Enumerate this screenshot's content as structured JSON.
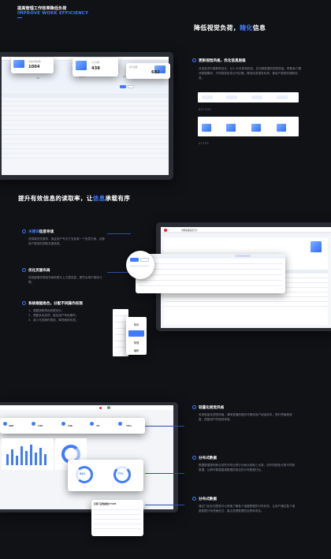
{
  "header": {
    "title_cn": "提高管理工作效率降低负荷",
    "title_en": "IMPROVE WORK EFFICIENCY"
  },
  "section1": {
    "heading_pre": "降低视觉负荷，",
    "heading_accent": "精化",
    "heading_post": "信息",
    "point_title": "更新视觉风格，优化信息层级",
    "point_body": "对信息进行更新再设计，以1.3x字体和弃选，并切换数据的视觉层级，帮助每个模块数据模块，不同类型信息分开区隔，降低信息视觉负荷，使用户更快的捕获信息。",
    "before_label": "BEFORE",
    "after_label": "AFTER",
    "stats": [
      {
        "label": "在线车辆总数",
        "value": "1004"
      },
      {
        "label": "今日新增",
        "value": "438"
      },
      {
        "label": "累计总数",
        "value": "682"
      }
    ]
  },
  "section2": {
    "heading_pre": "提升有效信息的读取率，让",
    "heading_accent": "信息",
    "heading_post": "承载有序",
    "points": [
      {
        "title_accent": "关键词",
        "title_post": "信息导读",
        "body": "选择高亮关键词，保证用户专注于当前某一个信息方面，且使用户更快的获取关键信息。"
      },
      {
        "title_accent": "",
        "title_post": "优化页面布局",
        "body": "将批量操作按钮布局到表头上方更突显，更符合用户使用习惯。"
      },
      {
        "title_accent": "",
        "title_post": "系统根据角色，分配不同操作权限",
        "body": "1、调整按照角色权限划分。\n2、调整多余选项，保证用户有用操作。\n3、减少可选操作按钮，降低使用负担。"
      }
    ],
    "menu": [
      "新增",
      "管理",
      "编辑"
    ],
    "app_title": "中国联通运营门户"
  },
  "section3": {
    "points": [
      {
        "title": "轻量化视觉风格",
        "body": "采用轻量化视觉风格，清晰易懂的图形可降低用户阅读成本，提升界面美观度，提高用户的使用体验。"
      },
      {
        "title": "分布式数据",
        "body": "根据数据类别和业务的不同分类行为两大类和三大类，用不同颜色代表不同的数据，让跨环数据直观数据的各自的分布数据行业。"
      },
      {
        "title": "分布式数据",
        "body": "通过门店标志图表可以快速了解各个维度数据的分布状态，让用户通过各个维度数据分布快速定位。重点查看数据的走势和变化。"
      }
    ],
    "kpis": [
      "296",
      "142",
      "13k",
      "73",
      "72%"
    ],
    "rings": [
      "84%",
      "77%"
    ],
    "table_title": "近期门店数据统计TOP5"
  },
  "colors": {
    "accent": "#3f7bff",
    "background": "#111216"
  }
}
